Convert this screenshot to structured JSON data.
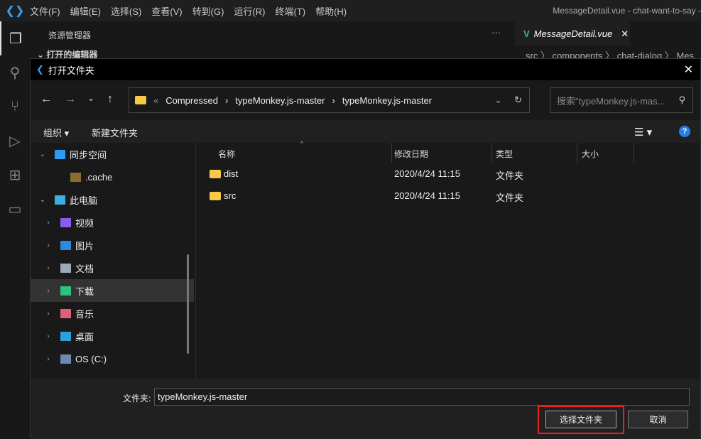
{
  "titlebar": {
    "menus": [
      "文件(F)",
      "编辑(E)",
      "选择(S)",
      "查看(V)",
      "转到(G)",
      "运行(R)",
      "终端(T)",
      "帮助(H)"
    ],
    "window_title": "MessageDetail.vue - chat-want-to-say -"
  },
  "sidebar": {
    "title": "资源管理器",
    "more": "···",
    "open_editors": "打开的编辑器"
  },
  "editor": {
    "tab": "MessageDetail.vue",
    "breadcrumb": "src 〉 components 〉 chat-dialog 〉 Mes"
  },
  "dialog": {
    "title": "打开文件夹",
    "address": {
      "overflow": "«",
      "segments": [
        "Compressed",
        "typeMonkey.js-master",
        "typeMonkey.js-master"
      ]
    },
    "search_placeholder": "搜索\"typeMonkey.js-mas...",
    "toolbar": {
      "organize": "组织 ▾",
      "new_folder": "新建文件夹"
    },
    "tree": [
      {
        "label": "同步空间",
        "chev": "⌄",
        "indent": 0,
        "color": "#2b9bf4"
      },
      {
        "label": ".cache",
        "chev": "",
        "indent": 1,
        "color": "#8a6d2e"
      },
      {
        "label": "此电脑",
        "chev": "⌄",
        "indent": 0,
        "color": "#3ab0e0"
      },
      {
        "label": "视频",
        "chev": "›",
        "indent": 1,
        "color": "#8a5cf0"
      },
      {
        "label": "图片",
        "chev": "›",
        "indent": 1,
        "color": "#2a8ae0"
      },
      {
        "label": "文档",
        "chev": "›",
        "indent": 1,
        "color": "#9aa8b8"
      },
      {
        "label": "下载",
        "chev": "›",
        "indent": 1,
        "color": "#2ec27e",
        "selected": true
      },
      {
        "label": "音乐",
        "chev": "›",
        "indent": 1,
        "color": "#e0607a"
      },
      {
        "label": "桌面",
        "chev": "›",
        "indent": 1,
        "color": "#2aa0e0"
      },
      {
        "label": "OS (C:)",
        "chev": "›",
        "indent": 1,
        "color": "#6a8ab0"
      }
    ],
    "columns": [
      "名称",
      "修改日期",
      "类型",
      "大小"
    ],
    "files": [
      {
        "name": "dist",
        "date": "2020/4/24 11:15",
        "type": "文件夹"
      },
      {
        "name": "src",
        "date": "2020/4/24 11:15",
        "type": "文件夹"
      }
    ],
    "folder_label": "文件夹:",
    "folder_value": "typeMonkey.js-master",
    "select_button": "选择文件夹",
    "cancel_button": "取消"
  }
}
